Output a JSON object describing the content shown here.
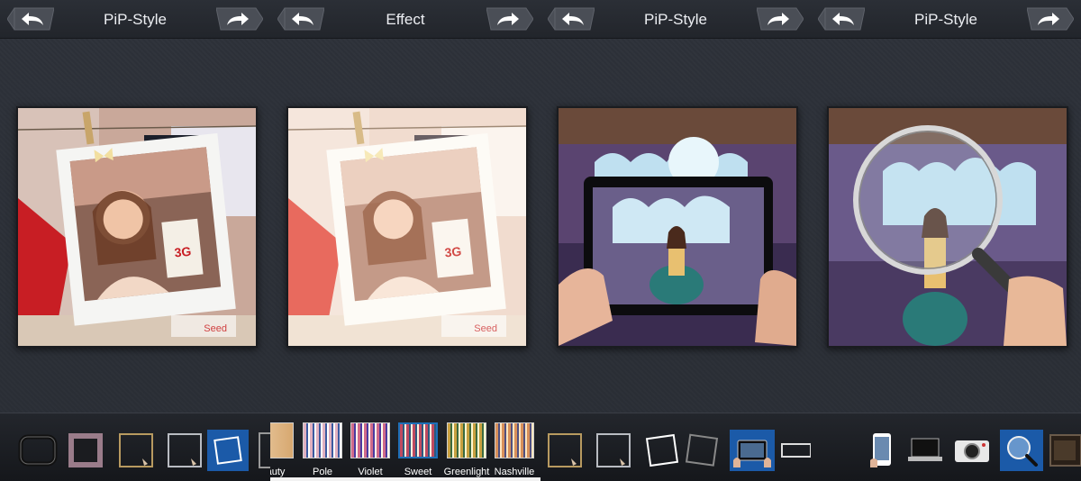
{
  "screens": [
    {
      "title": "PiP-Style"
    },
    {
      "title": "Effect"
    },
    {
      "title": "PiP-Style"
    },
    {
      "title": "PiP-Style"
    }
  ],
  "icons": {
    "back": "back-arrow-icon",
    "forward": "forward-arrow-icon"
  },
  "filters": [
    "auty",
    "Pole",
    "Violet",
    "Sweet",
    "Greenlight",
    "Nashville"
  ],
  "selected_filter": "Sweet",
  "photo_text": {
    "badge": "3G",
    "watermark": "Seed"
  },
  "colors": {
    "accent": "#1b5aa8",
    "topbar": "#24272d",
    "background": "#2c3038"
  }
}
